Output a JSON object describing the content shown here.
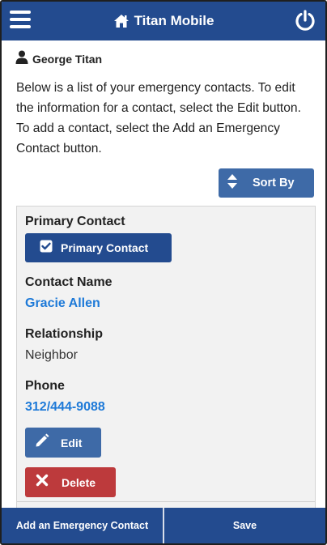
{
  "header": {
    "title": "Titan Mobile",
    "menu_icon": "hamburger-menu-icon",
    "home_icon": "home-icon",
    "power_icon": "power-icon",
    "background": "#234b8f"
  },
  "user": {
    "name": "George Titan",
    "icon": "user-icon"
  },
  "intro_text": "Below is a list of your emergency contacts. To edit the information for a contact, select the Edit button. To add a contact, select the Add an Emergency Contact button.",
  "sort": {
    "label": "Sort By",
    "icon": "sort-icon"
  },
  "contact": {
    "primary_heading": "Primary Contact",
    "primary_button_label": "Primary Contact",
    "primary_checked": true,
    "name_heading": "Contact Name",
    "name": "Gracie Allen",
    "relationship_heading": "Relationship",
    "relationship": "Neighbor",
    "phone_heading": "Phone",
    "phone": "312/444-9088",
    "edit_label": "Edit",
    "delete_label": "Delete"
  },
  "footer": {
    "add_label": "Add an Emergency Contact",
    "save_label": "Save"
  },
  "colors": {
    "primary": "#234b8f",
    "accent": "#3e6aa7",
    "link": "#1e7ad8",
    "danger": "#bd3a3c",
    "card_bg": "#f2f2f2"
  }
}
